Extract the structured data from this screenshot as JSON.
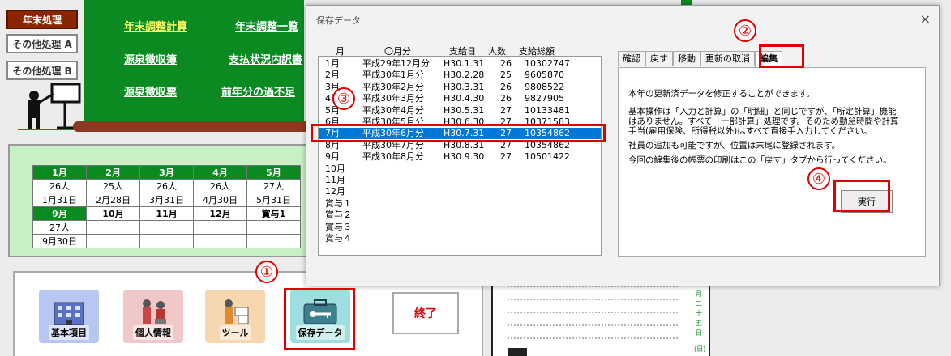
{
  "left_menu": {
    "items": [
      {
        "label": "年末処理"
      },
      {
        "label": "その他処理 A"
      },
      {
        "label": "その他処理 B"
      }
    ]
  },
  "green_links": {
    "row1": [
      "年末調整計算",
      "年末調整一覧"
    ],
    "row2": [
      "源泉徴収簿",
      "支払状況内訳書"
    ],
    "row3": [
      "源泉徴収票",
      "前年分の過不足"
    ]
  },
  "calendar": {
    "row1": [
      "1月",
      "2月",
      "3月",
      "4月",
      "5月"
    ],
    "row2": [
      "26人",
      "25人",
      "26人",
      "26人",
      "27人"
    ],
    "row3": [
      "1月31日",
      "2月28日",
      "3月31日",
      "4月30日",
      "5月31日"
    ],
    "row4": [
      "9月",
      "10月",
      "11月",
      "12月",
      "賞与1"
    ],
    "row5": [
      "27人",
      "",
      "",
      "",
      ""
    ],
    "row6": [
      "9月30日",
      "",
      "",
      "",
      ""
    ]
  },
  "bottom_buttons": {
    "basic": "基本項目",
    "personal": "個人情報",
    "tools": "ツール",
    "saved": "保存データ",
    "end": "終了"
  },
  "doc_side": {
    "chars": [
      "月",
      "二",
      "十",
      "五",
      "日",
      "(日)"
    ]
  },
  "dialog": {
    "title": "保存データ",
    "close": "×",
    "headers": {
      "month": "月",
      "period": "〇月分",
      "paydate": "支給日",
      "count": "人数",
      "total": "支給総額"
    },
    "rows": [
      {
        "m": "1月",
        "p": "平成29年12月分",
        "d": "H30.1.31",
        "n": "26",
        "t": "10302747"
      },
      {
        "m": "2月",
        "p": "平成30年1月分",
        "d": "H30.2.28",
        "n": "25",
        "t": "9605870"
      },
      {
        "m": "3月",
        "p": "平成30年2月分",
        "d": "H30.3.31",
        "n": "26",
        "t": "9808522"
      },
      {
        "m": "4月",
        "p": "平成30年3月分",
        "d": "H30.4.30",
        "n": "26",
        "t": "9827905"
      },
      {
        "m": "5月",
        "p": "平成30年4月分",
        "d": "H30.5.31",
        "n": "27",
        "t": "10133481"
      },
      {
        "m": "6月",
        "p": "平成30年5月分",
        "d": "H30.6.30",
        "n": "27",
        "t": "10371583"
      },
      {
        "m": "7月",
        "p": "平成30年6月分",
        "d": "H30.7.31",
        "n": "27",
        "t": "10354862"
      },
      {
        "m": "8月",
        "p": "平成30年7月分",
        "d": "H30.8.31",
        "n": "27",
        "t": "10354862"
      },
      {
        "m": "9月",
        "p": "平成30年8月分",
        "d": "H30.9.30",
        "n": "27",
        "t": "10501422"
      },
      {
        "m": "10月",
        "p": "",
        "d": "",
        "n": "",
        "t": ""
      },
      {
        "m": "11月",
        "p": "",
        "d": "",
        "n": "",
        "t": ""
      },
      {
        "m": "12月",
        "p": "",
        "d": "",
        "n": "",
        "t": ""
      },
      {
        "m": "賞与１",
        "p": "",
        "d": "",
        "n": "",
        "t": ""
      },
      {
        "m": "賞与２",
        "p": "",
        "d": "",
        "n": "",
        "t": ""
      },
      {
        "m": "賞与３",
        "p": "",
        "d": "",
        "n": "",
        "t": ""
      },
      {
        "m": "賞与４",
        "p": "",
        "d": "",
        "n": "",
        "t": ""
      }
    ],
    "selected_index": 6,
    "tabs": [
      "確認",
      "戻す",
      "移動",
      "更新の取消",
      "編集"
    ],
    "active_tab": "編集",
    "panel": {
      "line1": "本年の更新済データを修正することができます。",
      "line2": "基本操作は「入力と計算」の「明細」と同じですが、「所定計算」機能",
      "line3": "はありません。すべて「一部計算」処理です。そのため勤怠時間や計算",
      "line4": "手当(雇用保険、所得税以外)はすべて直接手入力してください。",
      "line5": "社員の追加も可能ですが、位置は末尾に登録されます。",
      "line6": "今回の編集後の帳票の印刷はこの「戻す」タブから行ってください。"
    },
    "execute": "実行"
  },
  "markers": {
    "m1": "①",
    "m2": "②",
    "m3": "③",
    "m4": "④"
  },
  "colors": {
    "green": "#0a8a21",
    "highlight_red": "#e00000",
    "selection_blue": "#0078d7"
  }
}
